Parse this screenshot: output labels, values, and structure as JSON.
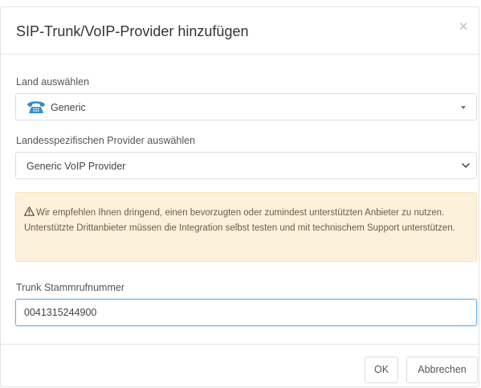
{
  "dialog": {
    "title": "SIP-Trunk/VoIP-Provider hinzufügen",
    "close_icon": "close-icon"
  },
  "country": {
    "label": "Land auswählen",
    "selected": "Generic",
    "icon": "phone-icon"
  },
  "provider": {
    "label": "Landesspezifischen Provider auswählen",
    "selected": "Generic VoIP Provider"
  },
  "alert": {
    "icon": "warning-icon",
    "text": "Wir empfehlen Ihnen dringend, einen bevorzugten oder zumindest unterstützten Anbieter zu nutzen. Unterstützte Drittanbieter müssen die Integration selbst testen und mit technischem Support unterstützen.",
    "background": "#fcf1da"
  },
  "trunk_number": {
    "label": "Trunk Stammrufnummer",
    "value": "0041315244900"
  },
  "footer": {
    "ok_label": "OK",
    "cancel_label": "Abbrechen"
  },
  "colors": {
    "focus_border": "#66afe9",
    "phone_icon": "#2f8fce"
  }
}
